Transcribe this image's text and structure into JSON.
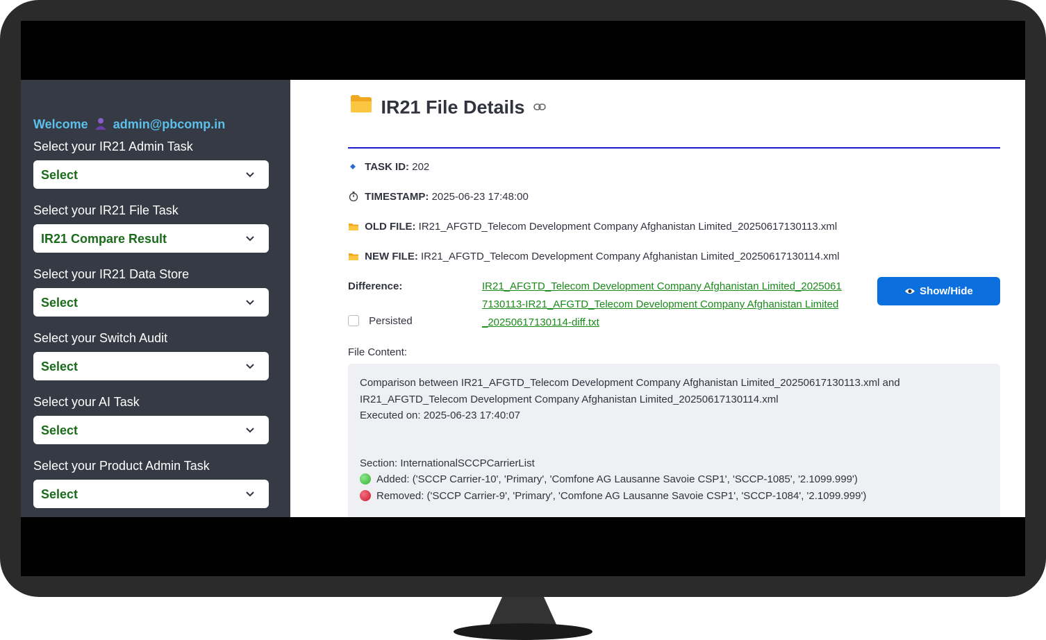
{
  "sidebar": {
    "welcome_prefix": "Welcome",
    "user_email": "admin@pbcomp.in",
    "tasks": [
      {
        "label": "Select your IR21 Admin Task",
        "value": "Select"
      },
      {
        "label": "Select your IR21 File Task",
        "value": "IR21 Compare Result"
      },
      {
        "label": "Select your IR21 Data Store",
        "value": "Select"
      },
      {
        "label": "Select your Switch Audit",
        "value": "Select"
      },
      {
        "label": "Select your AI Task",
        "value": "Select"
      },
      {
        "label": "Select your Product Admin Task",
        "value": "Select"
      }
    ]
  },
  "main": {
    "title": "IR21 File Details",
    "task_id_label": "TASK ID:",
    "task_id": "202",
    "timestamp_label": "TIMESTAMP:",
    "timestamp": "2025-06-23 17:48:00",
    "old_file_label": "OLD FILE:",
    "old_file": "IR21_AFGTD_Telecom Development Company Afghanistan Limited_20250617130113.xml",
    "new_file_label": "NEW FILE:",
    "new_file": "IR21_AFGTD_Telecom Development Company Afghanistan Limited_20250617130114.xml",
    "difference_label": "Difference:",
    "difference_link": "IR21_AFGTD_Telecom Development Company Afghanistan Limited_20250617130113-IR21_AFGTD_Telecom Development Company Afghanistan Limited_20250617130114-diff.txt",
    "persisted_label": "Persisted",
    "show_hide_label": "Show/Hide",
    "file_content_label": "File Content:",
    "content": {
      "line1": "Comparison between IR21_AFGTD_Telecom Development Company Afghanistan Limited_20250617130113.xml and",
      "line2": "IR21_AFGTD_Telecom Development Company Afghanistan Limited_20250617130114.xml",
      "line3": "Executed on: 2025-06-23 17:40:07",
      "section": "Section: InternationalSCCPCarrierList",
      "added": "Added: ('SCCP Carrier-10', 'Primary', 'Comfone AG Lausanne Savoie CSP1', 'SCCP-1085', '2.1099.999')",
      "removed": "Removed: ('SCCP Carrier-9', 'Primary', 'Comfone AG Lausanne Savoie CSP1', 'SCCP-1084', '2.1099.999')"
    }
  },
  "colors": {
    "sidebar_bg": "#363a44",
    "welcome": "#5bc0eb",
    "select_text": "#1a6b1a",
    "link": "#1a8a1a",
    "button": "#0b6fde",
    "rule": "#1a1acc",
    "added_dot": "#3cc43c",
    "removed_dot": "#e0283c"
  },
  "icons": [
    "user-icon",
    "chevron-down-icon",
    "folder-icon",
    "link-icon",
    "diamond-icon",
    "stopwatch-icon",
    "eye-icon"
  ]
}
